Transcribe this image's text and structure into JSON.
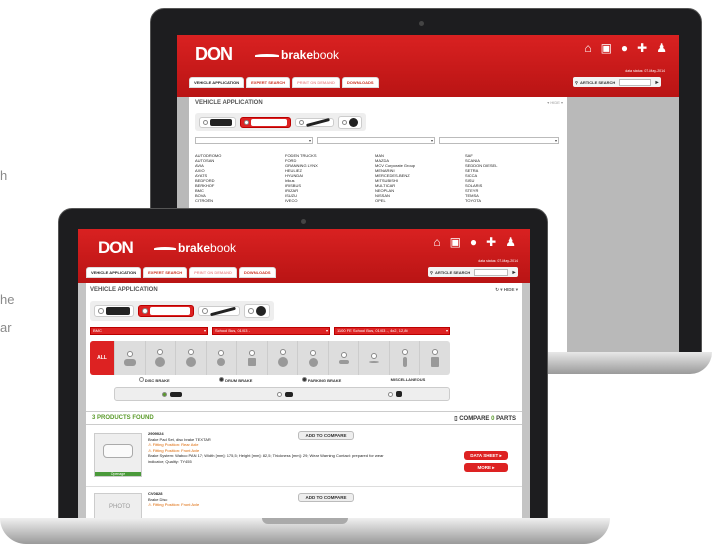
{
  "side_fragments": [
    "h",
    "he",
    "ar"
  ],
  "back_app": {
    "logo": "DON",
    "brand_bold": "brake",
    "brand_light": "book",
    "date_status": "data status: 07-May-2014",
    "tabs": [
      "VEHICLE APPLICATION",
      "EXPERT SEARCH",
      "PRINT ON DEMAND",
      "DOWNLOADS"
    ],
    "search_label": "ARTICLE SEARCH",
    "section_title": "VEHICLE APPLICATION",
    "hide_label": "▾ HIDE ▾",
    "brands": [
      [
        "AUTODROMO",
        "FODEN TRUCKS",
        "MAN",
        "SAF"
      ],
      [
        "AUTOSAN",
        "FORD",
        "MAZDA",
        "SCANIA"
      ],
      [
        "AVIA",
        "GRANNING LYNX",
        "MCV Corporate Group",
        "SEDDON DIESEL"
      ],
      [
        "AXIO",
        "HEULIEZ",
        "MENARINI",
        "SETRA"
      ],
      [
        "AYATS",
        "HYUNDAI",
        "MERCEDES-BENZ",
        "SICCA"
      ],
      [
        "BEDFORD",
        "Irikus",
        "MITSUBISHI",
        "SISU"
      ],
      [
        "BERKHOF",
        "IRISBUS",
        "MULTICAR",
        "SOLARIS"
      ],
      [
        "BMC",
        "IRIZAR",
        "NEOPLAN",
        "STEYR"
      ],
      [
        "BOVA",
        "ISUZU",
        "NISSAN",
        "TEMSA"
      ],
      [
        "CITROËN",
        "IVECO",
        "OPEL",
        "TOYOTA"
      ]
    ]
  },
  "front_app": {
    "logo": "DON",
    "brand_bold": "brake",
    "brand_light": "book",
    "date_status": "data status: 07-May-2014",
    "tabs": [
      "VEHICLE APPLICATION",
      "EXPERT SEARCH",
      "PRINT ON DEMAND",
      "DOWNLOADS"
    ],
    "search_label": "ARTICLE SEARCH",
    "section_title": "VEHICLE APPLICATION",
    "hide_label": "▾ HIDE ▾",
    "filters": [
      "BMC",
      "School Bus, 01/03 -",
      "1100 FE School Bus, 01/03 -, 4x2, 12,8t"
    ],
    "all_label": "ALL",
    "brake_types": [
      "DISC BRAKE",
      "DRUM BRAKE",
      "PARKING BRAKE",
      "MISCELLANEOUS"
    ],
    "products_found_count": "3",
    "products_found_label": "PRODUCTS FOUND",
    "compare_label": "COMPARE",
    "compare_count": "0",
    "compare_suffix": "PARTS",
    "products": [
      {
        "code": "2909024",
        "name": "Brake Pad Set, disc brake TEXTAR",
        "position": "Fitting Position: Rear Axle",
        "position2": "Fitting Position: Front Axle",
        "spec": "Brake System: Wabco PAN 17; Width [mm]: 175,5; Height [mm]: 82,5; Thickness [mm]: 29; Wear Warning Contact: prepared for wear indicator; Quality: TY455",
        "thumb_tag": "Openage",
        "compare_btn": "ADD TO COMPARE",
        "datasheet_btn": "DATA SHEET ▸",
        "more_btn": "MORE ▸"
      },
      {
        "code": "CV0828",
        "name": "Brake Disc",
        "position": "Fitting Position: Front Axle",
        "thumb_label": "PHOTO",
        "compare_btn": "ADD TO COMPARE"
      }
    ]
  },
  "colors": {
    "brand_red": "#d22020",
    "accent_green": "#5a9a2a"
  }
}
